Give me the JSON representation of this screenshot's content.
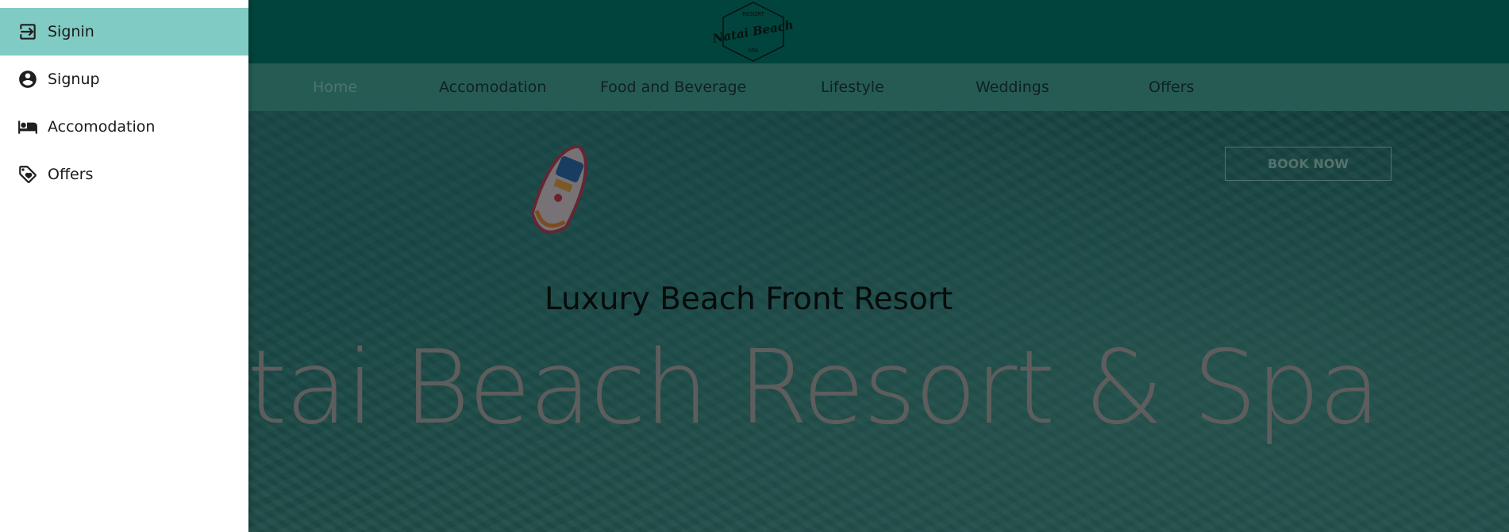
{
  "colors": {
    "topbar": "#007d6f",
    "navbar": "#45a699",
    "drawer_selected": "#80cbc4",
    "active_nav": "#8fd1c7"
  },
  "logo": {
    "top_text": "RESORT",
    "main_text": "Natai Beach",
    "bottom_text": "SPA"
  },
  "nav": {
    "items": [
      {
        "label": "Home",
        "active": true
      },
      {
        "label": "Accomodation"
      },
      {
        "label": "Food and Beverage"
      },
      {
        "label": "Lifestyle"
      },
      {
        "label": "Weddings"
      },
      {
        "label": "Offers"
      }
    ]
  },
  "hero": {
    "book_button": "BOOK NOW",
    "subtitle": "Luxury Beach Front Resort",
    "headline": "atai Beach Resort & Spa"
  },
  "drawer": {
    "items": [
      {
        "label": "Signin",
        "icon": "login-icon",
        "selected": true
      },
      {
        "label": "Signup",
        "icon": "account-circle-icon"
      },
      {
        "label": "Accomodation",
        "icon": "bed-icon"
      },
      {
        "label": "Offers",
        "icon": "tag-icon"
      }
    ]
  }
}
